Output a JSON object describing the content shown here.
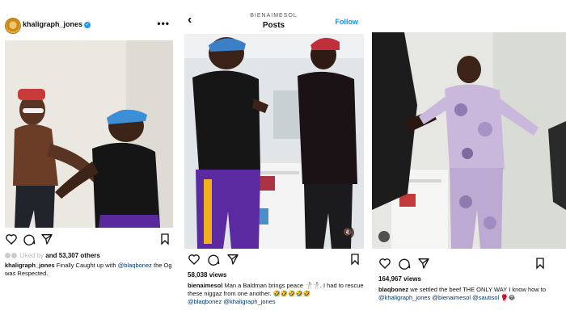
{
  "post1": {
    "username": "khaligraph_jones",
    "likes_prefix": "Liked by",
    "likes_text": "and 53,307 others",
    "caption_user": "khaligraph_jones",
    "caption_text": "Finally Caught up with",
    "caption_mention": "@blaqbonez",
    "caption_text2": "the Og was  Respected."
  },
  "post2": {
    "account": "BIENAIMESOL",
    "title": "Posts",
    "follow": "Follow",
    "views": "58,038 views",
    "caption_user": "bienaimesol",
    "caption_text": "Man a Baldman brings peace 🤺🤺. I had to rescue these niggaz from one another. 🤣🤣🤣🤣🤣",
    "mention1": "@blaqbonez",
    "mention2": "@khaligraph_jones"
  },
  "post3": {
    "views": "164,967 views",
    "caption_user": "blaqbonez",
    "caption_text": "we settled the beef THE ONLY WAY I know how to",
    "mention1": "@khaligraph_jones",
    "mention2": "@bienaimesol",
    "mention3": "@sautisol",
    "caption_end": "🥊😂"
  },
  "icons": [
    "heart-icon",
    "comment-icon",
    "share-icon",
    "bookmark-icon",
    "more-icon",
    "back-icon",
    "mute-icon",
    "verified-icon"
  ],
  "colors": {
    "link": "#0095f6",
    "mention": "#00376b",
    "verified": "#1d9bf0"
  }
}
